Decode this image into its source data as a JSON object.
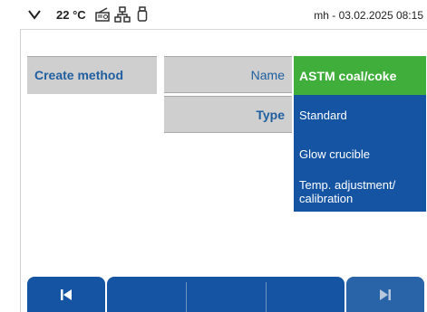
{
  "status_bar": {
    "temperature": "22 °C",
    "user_datetime": "mh - 03.02.2025 08:15",
    "icons": [
      "chevron-down-icon",
      "radio-icon",
      "network-icon",
      "usb-icon"
    ]
  },
  "left_panel": {
    "title": "Create method"
  },
  "fields": {
    "name_label": "Name",
    "type_label": "Type"
  },
  "options": [
    {
      "label": "ASTM coal/coke",
      "selected": true
    },
    {
      "label": "Standard",
      "selected": false
    },
    {
      "label": "Glow crucible",
      "selected": false
    },
    {
      "label": "Temp. adjustment/ calibration",
      "selected": false
    }
  ],
  "bottom_bar": {
    "buttons": [
      "skip-back-icon",
      "empty",
      "empty",
      "empty",
      "skip-forward-icon"
    ]
  },
  "colors": {
    "accent_blue": "#1454a3",
    "selected_green": "#3fae3a",
    "label_gray": "#cfcfcf",
    "text_blue": "#1f5fa0"
  }
}
